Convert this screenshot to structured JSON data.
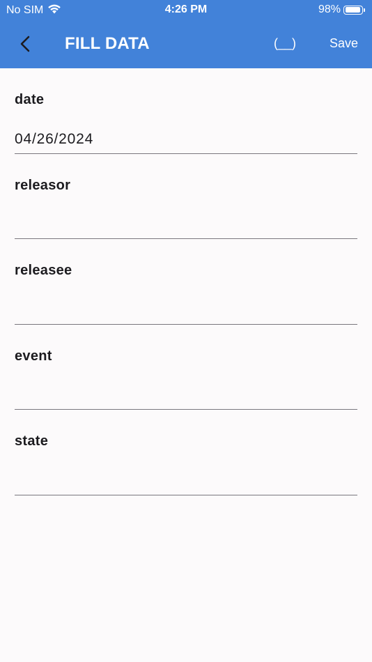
{
  "status_bar": {
    "carrier": "No SIM",
    "time": "4:26 PM",
    "battery_percent": "98%",
    "battery_level": 0.98
  },
  "app_bar": {
    "title": "FILL DATA",
    "blank_action_label": "(__)",
    "save_label": "Save",
    "background_color": "#4282d9"
  },
  "form": {
    "fields": [
      {
        "label": "date",
        "value": "04/26/2024"
      },
      {
        "label": "releasor",
        "value": ""
      },
      {
        "label": "releasee",
        "value": ""
      },
      {
        "label": "event",
        "value": ""
      },
      {
        "label": "state",
        "value": ""
      }
    ]
  },
  "icons": {
    "back": "chevron-left-icon",
    "wifi": "wifi-icon",
    "battery": "battery-icon"
  }
}
